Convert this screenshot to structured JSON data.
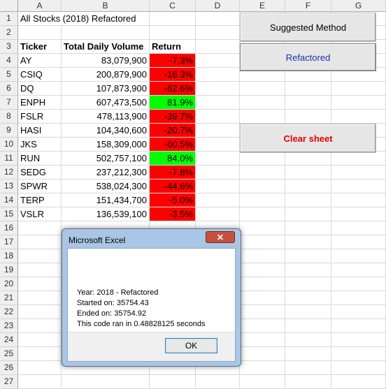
{
  "columns": [
    "A",
    "B",
    "C",
    "D",
    "E",
    "F",
    "G"
  ],
  "rows": [
    "1",
    "2",
    "3",
    "4",
    "5",
    "6",
    "7",
    "8",
    "9",
    "10",
    "11",
    "12",
    "13",
    "14",
    "15",
    "16",
    "17",
    "18",
    "19",
    "20",
    "21",
    "22",
    "23",
    "24",
    "25",
    "26",
    "27"
  ],
  "title_cell": "All Stocks (2018) Refactored",
  "headers": {
    "ticker": "Ticker",
    "volume": "Total Daily Volume",
    "return": "Return"
  },
  "stocks": [
    {
      "ticker": "AY",
      "volume": "83,079,900",
      "return": "-7.3%",
      "status": "neg"
    },
    {
      "ticker": "CSIQ",
      "volume": "200,879,900",
      "return": "-16.3%",
      "status": "neg"
    },
    {
      "ticker": "DQ",
      "volume": "107,873,900",
      "return": "-62.6%",
      "status": "neg"
    },
    {
      "ticker": "ENPH",
      "volume": "607,473,500",
      "return": "81.9%",
      "status": "pos"
    },
    {
      "ticker": "FSLR",
      "volume": "478,113,900",
      "return": "-39.7%",
      "status": "neg"
    },
    {
      "ticker": "HASI",
      "volume": "104,340,600",
      "return": "-20.7%",
      "status": "neg"
    },
    {
      "ticker": "JKS",
      "volume": "158,309,000",
      "return": "-60.5%",
      "status": "neg"
    },
    {
      "ticker": "RUN",
      "volume": "502,757,100",
      "return": "84.0%",
      "status": "pos"
    },
    {
      "ticker": "SEDG",
      "volume": "237,212,300",
      "return": "-7.8%",
      "status": "neg"
    },
    {
      "ticker": "SPWR",
      "volume": "538,024,300",
      "return": "-44.6%",
      "status": "neg"
    },
    {
      "ticker": "TERP",
      "volume": "151,434,700",
      "return": "-5.0%",
      "status": "neg"
    },
    {
      "ticker": "VSLR",
      "volume": "136,539,100",
      "return": "-3.5%",
      "status": "neg"
    }
  ],
  "buttons": {
    "suggested": "Suggested Method",
    "refactored": "Refactored",
    "clear": "Clear sheet"
  },
  "colors": {
    "negative": "#ff0000",
    "positive": "#00ff00",
    "refactored_text": "#1a2fb5",
    "clear_text": "#e00000"
  },
  "dialog": {
    "title": "Microsoft Excel",
    "close": "✕",
    "lines": [
      "Year: 2018 - Refactored",
      "Started on: 35754.43",
      "Ended on: 35754.92",
      "This code ran in 0.48828125 seconds"
    ],
    "ok": "OK"
  }
}
